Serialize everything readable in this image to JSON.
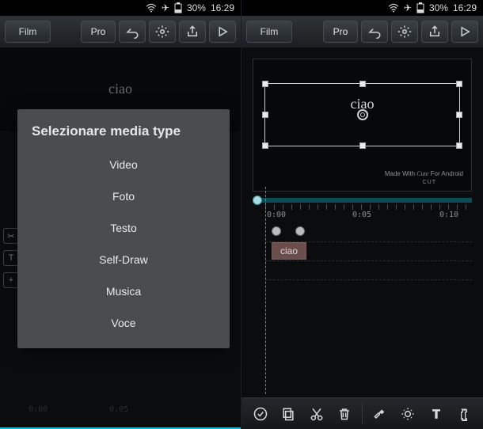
{
  "status": {
    "battery_pct": "30%",
    "time": "16:29"
  },
  "toolbar": {
    "film_label": "Film",
    "pro_label": "Pro"
  },
  "left": {
    "preview_text": "ciao",
    "dialog": {
      "title": "Selezionare media type",
      "items": [
        "Video",
        "Foto",
        "Testo",
        "Self-Draw",
        "Musica",
        "Voce"
      ]
    },
    "ruler": [
      "0:00",
      "0:05"
    ]
  },
  "right": {
    "selection_text": "ciao",
    "watermark": {
      "left": "Made With",
      "brand_top": "Cute",
      "brand_bottom": "CUT",
      "right": "For Android"
    },
    "ruler": [
      "0:00",
      "0:05",
      "0:10"
    ],
    "clip_label": "ciao"
  }
}
